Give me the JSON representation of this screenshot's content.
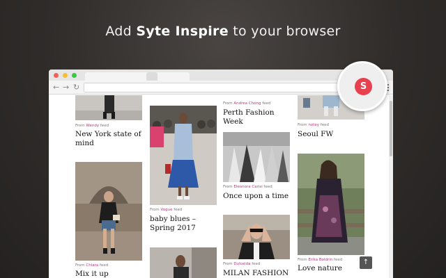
{
  "headline": {
    "prefix": "Add",
    "brand": "Syte Inspire",
    "suffix": "to your browser"
  },
  "syte_button": {
    "letter": "S",
    "color": "#e8404f"
  },
  "browser": {
    "nav_back": "←",
    "nav_forward": "→",
    "reload": "↻"
  },
  "feed": {
    "from_label": "From",
    "feed_label": "feed",
    "cards": [
      {
        "source": "Wendy",
        "title": "New York state of mind"
      },
      {
        "source": "Chiara",
        "title": "Mix it up"
      },
      {
        "source": "Vogue",
        "title": "baby blues – Spring 2017"
      },
      {
        "source": "Andrea Chong",
        "title": "Perth Fashion Week"
      },
      {
        "source": "Eleonora Carisi",
        "title": "Once upon a time"
      },
      {
        "source": "Dulceida",
        "title": "MILAN FASHION"
      },
      {
        "source": "notey",
        "title": "Seoul FW"
      },
      {
        "source": "Erika Boldrin",
        "title": "Love nature"
      }
    ],
    "scroll_top_icon": "↑"
  }
}
